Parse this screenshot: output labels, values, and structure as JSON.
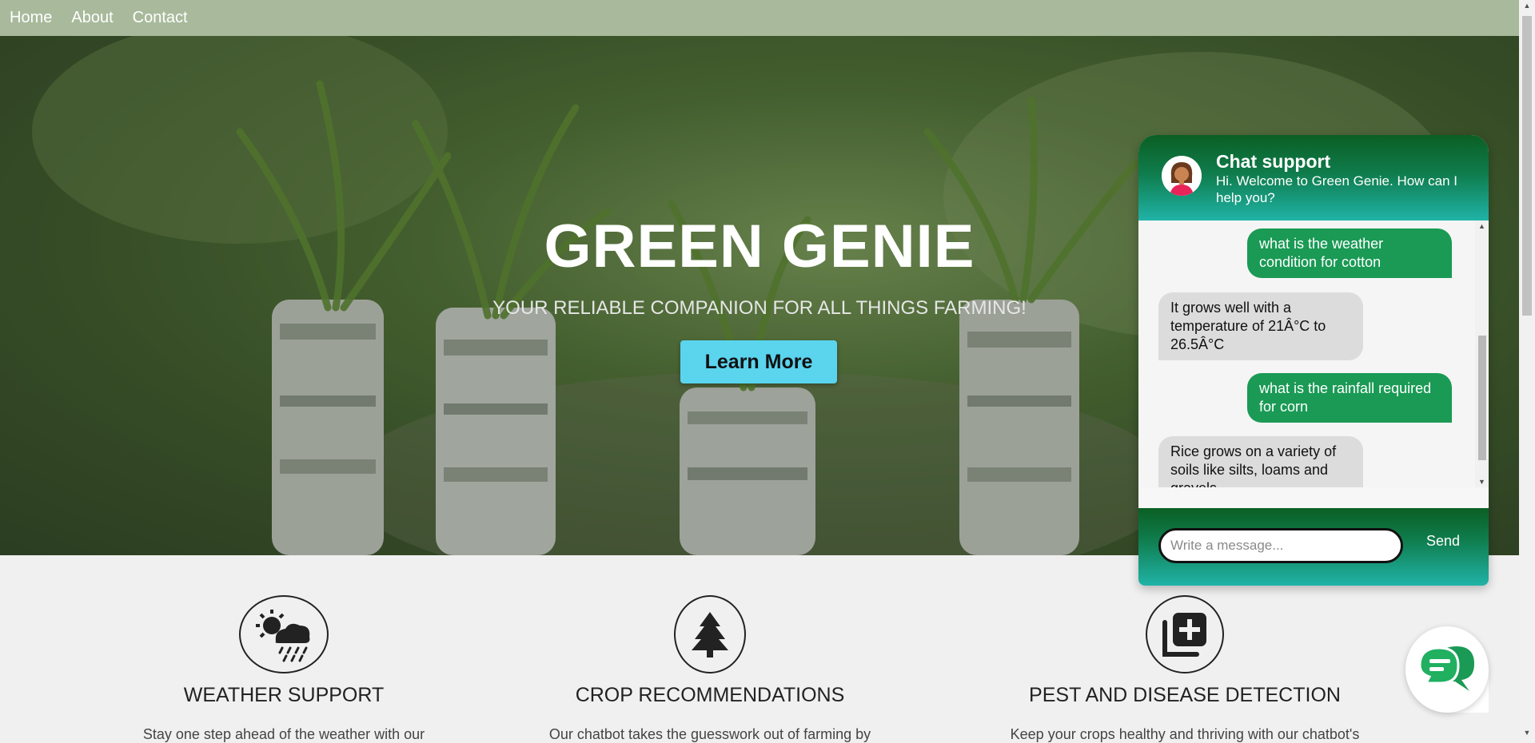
{
  "nav": {
    "items": [
      {
        "label": "Home"
      },
      {
        "label": "About"
      },
      {
        "label": "Contact"
      }
    ]
  },
  "hero": {
    "title": "GREEN GENIE",
    "subtitle": "YOUR RELIABLE COMPANION FOR ALL THINGS FARMING!",
    "cta_label": "Learn More",
    "cta_color": "#5bd4ee"
  },
  "features": [
    {
      "icon": "weather-icon",
      "title": "WEATHER SUPPORT",
      "text": "Stay one step ahead of the weather with our"
    },
    {
      "icon": "tree-icon",
      "title": "CROP RECOMMENDATIONS",
      "text": "Our chatbot takes the guesswork out of farming by"
    },
    {
      "icon": "add-copy-icon",
      "title": "PEST AND DISEASE DETECTION",
      "text": "Keep your crops healthy and thriving with our chatbot's"
    }
  ],
  "chat": {
    "title": "Chat support",
    "welcome": "Hi. Welcome to Green Genie. How can I help you?",
    "messages": [
      {
        "from": "user",
        "text": "what is the weather condition for cotton"
      },
      {
        "from": "bot",
        "text": "It grows well with a temperature of 21Â°C to 26.5Â°C"
      },
      {
        "from": "user",
        "text": "what is the rainfall required for corn"
      },
      {
        "from": "bot",
        "text": "Rice grows on a variety of soils like silts, loams and gravels"
      }
    ],
    "input_placeholder": "Write a message...",
    "send_label": "Send",
    "user_bubble_color": "#1a9a55",
    "bot_bubble_color": "#dcdcdc"
  },
  "colors": {
    "navbar": "#a8ba9b",
    "brand_green": "#0f7c4c",
    "teal": "#20b3a7"
  }
}
